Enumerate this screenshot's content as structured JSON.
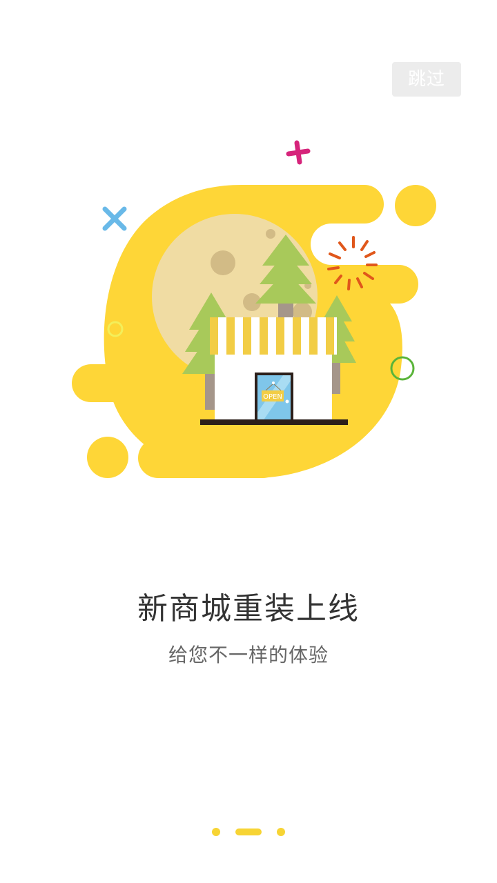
{
  "skip": {
    "label": "跳过"
  },
  "onboarding": {
    "title": "新商城重装上线",
    "subtitle": "给您不一样的体验",
    "sign_text": "OPEN"
  },
  "pager": {
    "total": 3,
    "active_index": 1
  },
  "colors": {
    "accent_yellow": "#fed637",
    "moon": "#f0dca3",
    "tree_green": "#a8c95a",
    "trunk": "#a5968a",
    "door_blue": "#7fc6ea",
    "skip_bg": "#ececec",
    "cross_blue": "#69b9e8",
    "plus_magenta": "#d6247b",
    "spark_orange": "#e0571b",
    "ring_green": "#5ab43a"
  },
  "icons": [
    "shop-illustration",
    "moon",
    "pine-tree",
    "open-sign",
    "x-mark",
    "plus-mark",
    "sparkle",
    "ring"
  ]
}
